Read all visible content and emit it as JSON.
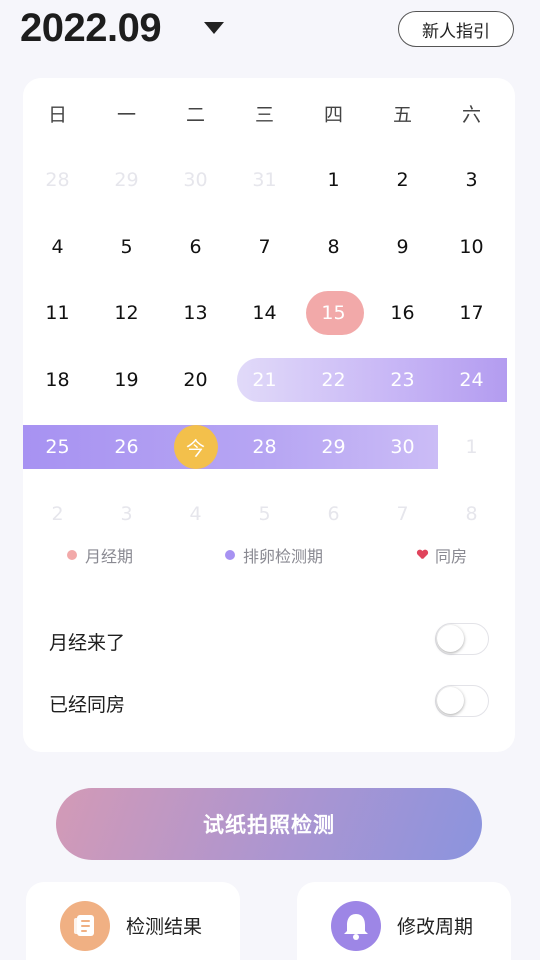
{
  "header": {
    "month": "2022.09",
    "guide_label": "新人指引"
  },
  "calendar": {
    "weekdays": [
      "日",
      "一",
      "二",
      "三",
      "四",
      "五",
      "六"
    ],
    "rows": [
      [
        "28",
        "29",
        "30",
        "31",
        "1",
        "2",
        "3"
      ],
      [
        "4",
        "5",
        "6",
        "7",
        "8",
        "9",
        "10"
      ],
      [
        "11",
        "12",
        "13",
        "14",
        "15",
        "16",
        "17"
      ],
      [
        "18",
        "19",
        "20",
        "21",
        "22",
        "23",
        "24"
      ],
      [
        "25",
        "26",
        "今",
        "28",
        "29",
        "30",
        "1"
      ],
      [
        "2",
        "3",
        "4",
        "5",
        "6",
        "7",
        "8"
      ]
    ]
  },
  "legend": {
    "period": "月经期",
    "ovulation": "排卵检测期",
    "intercourse": "同房"
  },
  "toggles": {
    "period_started": "月经来了",
    "had_intercourse": "已经同房"
  },
  "actions": {
    "scan_test": "试纸拍照检测",
    "results": "检测结果",
    "edit_cycle": "修改周期"
  },
  "colors": {
    "period": "#f2a9a9",
    "ovulation": "#a792f2",
    "today": "#f3c04b",
    "heart": "#e0445c"
  }
}
